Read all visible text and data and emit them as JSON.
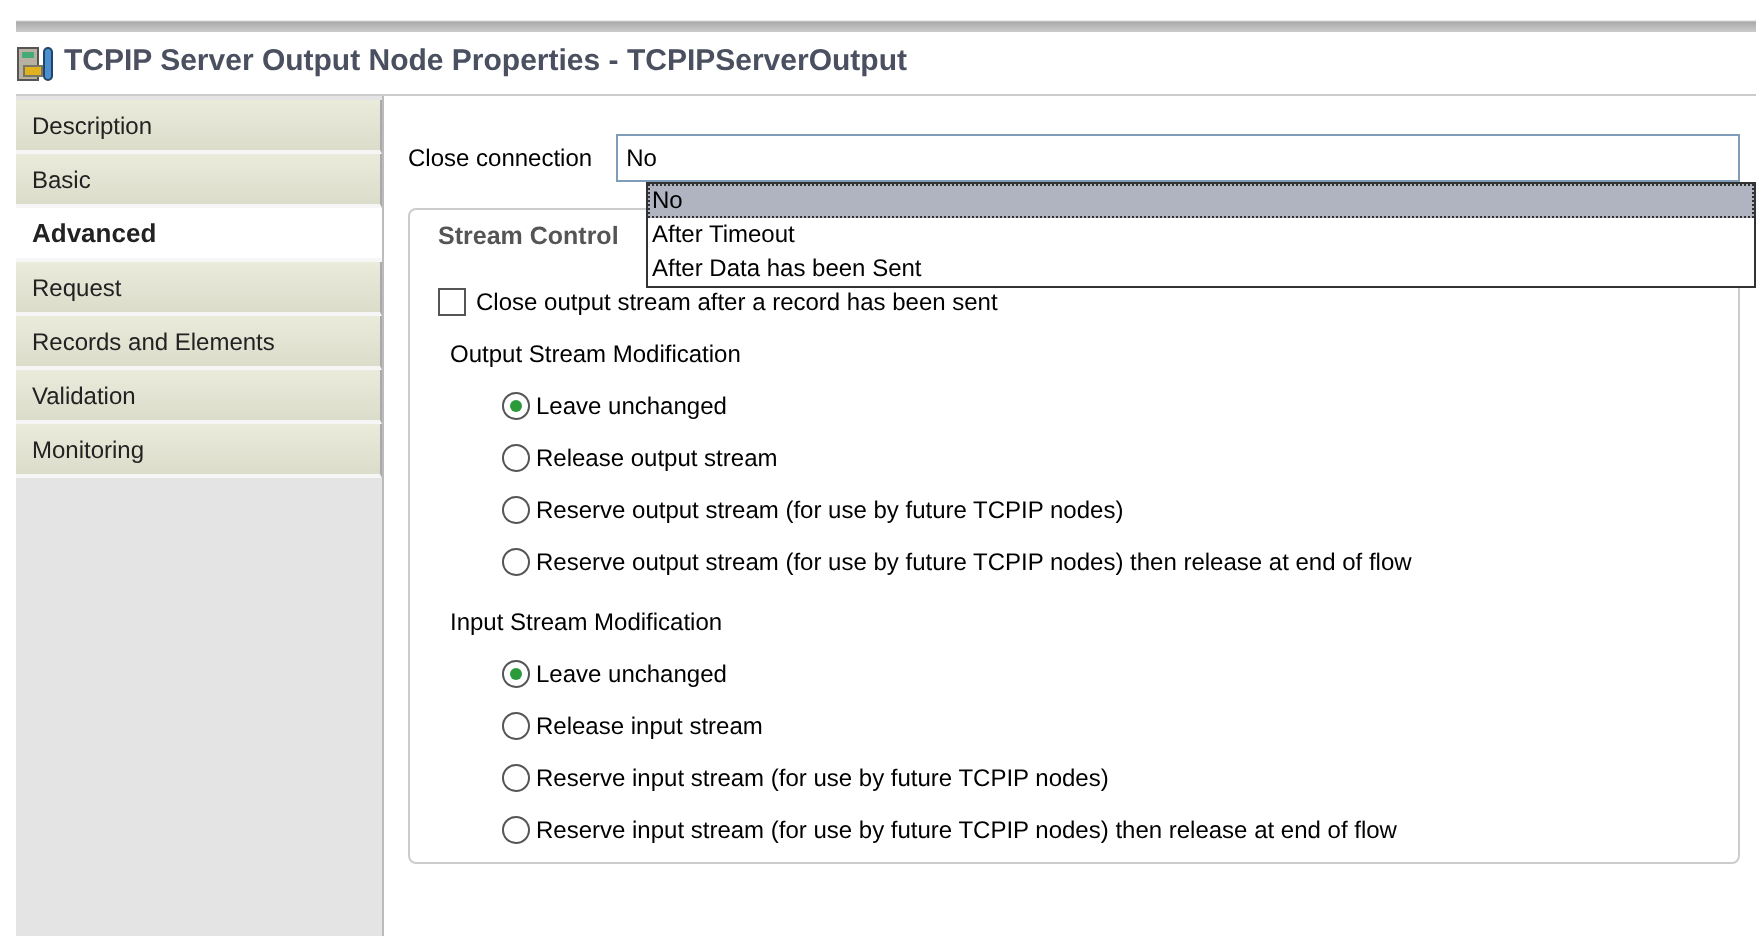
{
  "window": {
    "title": "TCPIP Server Output Node Properties - TCPIPServerOutput"
  },
  "sidebar": {
    "items": [
      {
        "label": "Description",
        "selected": false
      },
      {
        "label": "Basic",
        "selected": false
      },
      {
        "label": "Advanced",
        "selected": true
      },
      {
        "label": "Request",
        "selected": false
      },
      {
        "label": "Records and Elements",
        "selected": false
      },
      {
        "label": "Validation",
        "selected": false
      },
      {
        "label": "Monitoring",
        "selected": false
      }
    ]
  },
  "close_connection": {
    "label": "Close connection",
    "value": "No",
    "expanded": true,
    "options": [
      {
        "label": "No",
        "selected": true
      },
      {
        "label": "After Timeout",
        "selected": false
      },
      {
        "label": "After Data has been Sent",
        "selected": false
      }
    ]
  },
  "stream_control": {
    "title": "Stream Control",
    "checkbox": {
      "label": "Close output stream after a record has been sent",
      "checked": false
    },
    "groups": [
      {
        "title": "Output Stream Modification",
        "options": [
          {
            "label": "Leave unchanged",
            "selected": true
          },
          {
            "label": "Release output stream",
            "selected": false
          },
          {
            "label": "Reserve output stream (for use by future TCPIP nodes)",
            "selected": false
          },
          {
            "label": "Reserve output stream (for use by future TCPIP nodes) then release at end of flow",
            "selected": false
          }
        ]
      },
      {
        "title": "Input Stream Modification",
        "options": [
          {
            "label": "Leave unchanged",
            "selected": true
          },
          {
            "label": "Release input stream",
            "selected": false
          },
          {
            "label": "Reserve input stream (for use by future TCPIP nodes)",
            "selected": false
          },
          {
            "label": "Reserve input stream (for use by future TCPIP nodes) then release at end of flow",
            "selected": false
          }
        ]
      }
    ]
  }
}
